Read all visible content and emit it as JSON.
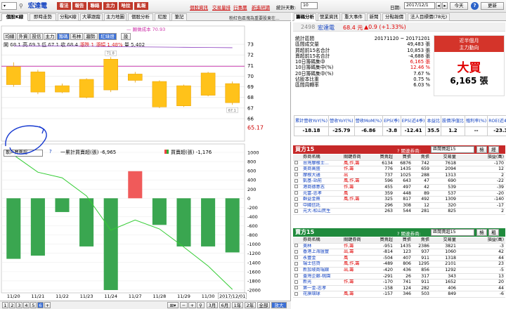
{
  "toolbar": {
    "symbol": "宏達電",
    "buttons": [
      "看法",
      "報告",
      "聯絡",
      "主力",
      "哈拉",
      "亂報"
    ],
    "links": [
      "個股資訊",
      "交易量排",
      "行事曆",
      "新進研讀"
    ],
    "days_label": "統計天數:",
    "days_value": "10",
    "date_label": "日期:",
    "date_value": "2017/12/1",
    "today_btn": "今天",
    "refresh_btn": "更新",
    "marker": "1"
  },
  "tabs_left": [
    "個股K線",
    "即時走勢",
    "分點K線",
    "大單跟蹤",
    "主力地圖",
    "個股分析",
    "紅股",
    "筆記"
  ],
  "tabs_right": [
    "籌碼分析",
    "營業資訊",
    "重大事件",
    "新聞",
    "分點報價",
    "法人目標價(78元)"
  ],
  "notice": "粉紅色區塊為重要股東在...",
  "chart": {
    "tool_buttons": [
      "均線",
      "外資",
      "投信",
      "主力",
      "籌碼",
      "布林",
      "趨勢",
      "紅綠燈",
      "設"
    ],
    "ohlc": {
      "open_label": "開",
      "open": "68.1",
      "high_label": "高",
      "high": "69.3",
      "low_label": "低",
      "low": "67.1",
      "close_label": "收",
      "close": "68.4",
      "chg_label": "漲跌",
      "chg": "1",
      "pct_label": "漲幅",
      "pct": "1.48%",
      "vol_label": "量",
      "vol": "5,402"
    },
    "ma_label": "願做成本 70.93",
    "price_axis": [
      "73",
      "72",
      "71",
      "70",
      "69",
      "68",
      "67",
      "66"
    ],
    "last_price": "65.17",
    "price_tag": "67.1",
    "high_tag": "71.8",
    "low_tag": "67.1",
    "dates": [
      "11/20",
      "11/21",
      "11/22",
      "11/23",
      "11/24",
      "11/27",
      "11/28",
      "11/29",
      "11/30",
      "2017/12/01"
    ],
    "year": "2017",
    "candles": [
      {
        "o": 70.9,
        "c": 69.2,
        "h": 71.3,
        "l": 69.0
      },
      {
        "o": 70.4,
        "c": 68.5,
        "h": 70.6,
        "l": 68.3
      },
      {
        "o": 69.1,
        "c": 68.5,
        "h": 69.3,
        "l": 68.4
      },
      {
        "o": 69.7,
        "c": 68.0,
        "h": 69.8,
        "l": 67.9
      },
      {
        "o": 71.6,
        "c": 68.7,
        "h": 71.8,
        "l": 68.5
      },
      {
        "o": 70.2,
        "c": 69.6,
        "h": 70.4,
        "l": 69.4
      },
      {
        "o": 69.5,
        "c": 67.1,
        "h": 69.6,
        "l": 67.0
      },
      {
        "o": 69.1,
        "c": 67.2,
        "h": 69.2,
        "l": 67.1
      },
      {
        "o": 70.3,
        "c": 68.2,
        "h": 70.4,
        "l": 68.1
      },
      {
        "o": 69.3,
        "c": 67.5,
        "h": 69.5,
        "l": 67.3
      }
    ],
    "ma_value": 70.93,
    "ma2": [
      72.85,
      72.83,
      72.84,
      72.82,
      72.78,
      72.76,
      72.74,
      72.72,
      72.7,
      72.68
    ]
  },
  "lower": {
    "select": "散戶買賣超",
    "legend1": "一累計買賣超(張) -6,965",
    "legend2": "買賣超(張) -1,176",
    "axis": [
      "1000",
      "800",
      "600",
      "400",
      "200",
      "0",
      "-200",
      "-400",
      "-600",
      "-800",
      "-1000",
      "-1200",
      "-1400",
      "-1600",
      "-1800",
      "-2000"
    ],
    "bars": [
      -1320,
      -1250,
      -300,
      -1050,
      -2000,
      590,
      -580,
      -1050,
      -1050,
      -1180
    ],
    "cum": [
      850,
      -150,
      -480,
      -1530,
      -3520,
      -2930,
      -3450,
      -4500,
      -5600,
      -6965
    ]
  },
  "bottom": {
    "pages": [
      "1",
      "2",
      "3",
      "4",
      "5",
      "6",
      "+"
    ],
    "active": "6",
    "zoom": [
      "3月",
      "6月",
      "1年",
      "2年",
      "全部",
      "放大"
    ],
    "tool": "放大"
  },
  "summary": {
    "code": "2498",
    "name": "宏達電",
    "price": "68.4 元",
    "change": "▲0.9 (+1.33%)",
    "rows": [
      [
        "統計區間",
        "20171120 ~ 20171201"
      ],
      [
        "區間成交量",
        "49,483 張"
      ],
      [
        "買超前15名合計",
        "10,853 張"
      ],
      [
        "賣超前15名合計",
        "-4,688 張"
      ],
      [
        "10日籌碼集中",
        "6,165 張"
      ],
      [
        "10日籌碼集中(%)",
        "12.46 %"
      ],
      [
        "20日籌碼集中(%)",
        "7.67 %"
      ],
      [
        "佔股本比重",
        "0.75 %"
      ],
      [
        "區間周轉率",
        "6.03 %"
      ]
    ],
    "box_title": "近半個月",
    "box_sub": "主力動向",
    "box_big": "大買",
    "box_val": "6,165 張"
  },
  "fin": {
    "heads": [
      "累計營收YoY(%)",
      "營收YoY(%)",
      "營收MoM(%)",
      "EPS(季)",
      "EPS(近4季)",
      "本益比",
      "股價淨值比",
      "殖利率(%)",
      "ROE(近4季)"
    ],
    "vals": [
      "-18.18",
      "-25.79",
      "-6.86",
      "-3.8",
      "-12.41",
      "35.5",
      "1.2",
      "--",
      "-23.3"
    ]
  },
  "buy": {
    "title": "買方15",
    "rel": "? 關連券商:",
    "sel": "區間買超15",
    "btn1": "檢",
    "btn2": "經",
    "cols": [
      "",
      "券商名稱",
      "關鍵券商",
      "買賣超",
      "買張",
      "賣張",
      "交易量",
      "損益(萬)"
    ],
    "rows": [
      [
        "台灣摩根士...",
        "風,作,籌",
        "6134",
        "6876",
        "742",
        "7618",
        "-170"
      ],
      [
        "美商高盛",
        "作,籌",
        "776",
        "1435",
        "659",
        "2094",
        "12"
      ],
      [
        "摩根大通",
        "出",
        "737",
        "1025",
        "288",
        "1313",
        "2"
      ],
      [
        "凱基-站前",
        "風,作,籌",
        "596",
        "643",
        "47",
        "690",
        "-22"
      ],
      [
        "港商德意志",
        "作,籌",
        "455",
        "497",
        "42",
        "539",
        "-39"
      ],
      [
        "元富-忠孝",
        "風",
        "359",
        "448",
        "89",
        "537",
        "-20"
      ],
      [
        "群益金鼎",
        "風,作,籌",
        "325",
        "817",
        "492",
        "1309",
        "-140"
      ],
      [
        "中國信託",
        "",
        "296",
        "308",
        "12",
        "320",
        "-17"
      ],
      [
        "元大-松山民生",
        "",
        "263",
        "544",
        "281",
        "825",
        "2"
      ]
    ]
  },
  "sell": {
    "title": "賣方15",
    "rel": "? 關連券商:",
    "sel": "區間賣超15",
    "btn1": "檢",
    "btn2": "粗",
    "cols": [
      "",
      "券商名稱",
      "關鍵券商",
      "買賣超",
      "買張",
      "賣張",
      "交易量",
      "損益(萬)"
    ],
    "rows": [
      [
        "美林",
        "作,籌",
        "-951",
        "1435",
        "2386",
        "3821",
        "-3"
      ],
      [
        "香港上海匯豐",
        "出,籌",
        "-814",
        "123",
        "937",
        "1060",
        "42"
      ],
      [
        "永豐金",
        "風",
        "-504",
        "407",
        "911",
        "1318",
        "44"
      ],
      [
        "瑞士信貸",
        "風,作,籌",
        "-489",
        "806",
        "1295",
        "2101",
        "23"
      ],
      [
        "新加坡商瑞銀",
        "出,籌",
        "-420",
        "436",
        "856",
        "1292",
        "-5"
      ],
      [
        "臺灣企銀-桃園",
        "",
        "-291",
        "26",
        "317",
        "343",
        "13"
      ],
      [
        "新光",
        "作,籌",
        "-170",
        "741",
        "911",
        "1652",
        "20"
      ],
      [
        "第一金-忠孝",
        "",
        "-158",
        "124",
        "282",
        "406",
        "44"
      ],
      [
        "花旗環球",
        "風,籌",
        "-157",
        "346",
        "503",
        "849",
        "-6"
      ]
    ]
  }
}
